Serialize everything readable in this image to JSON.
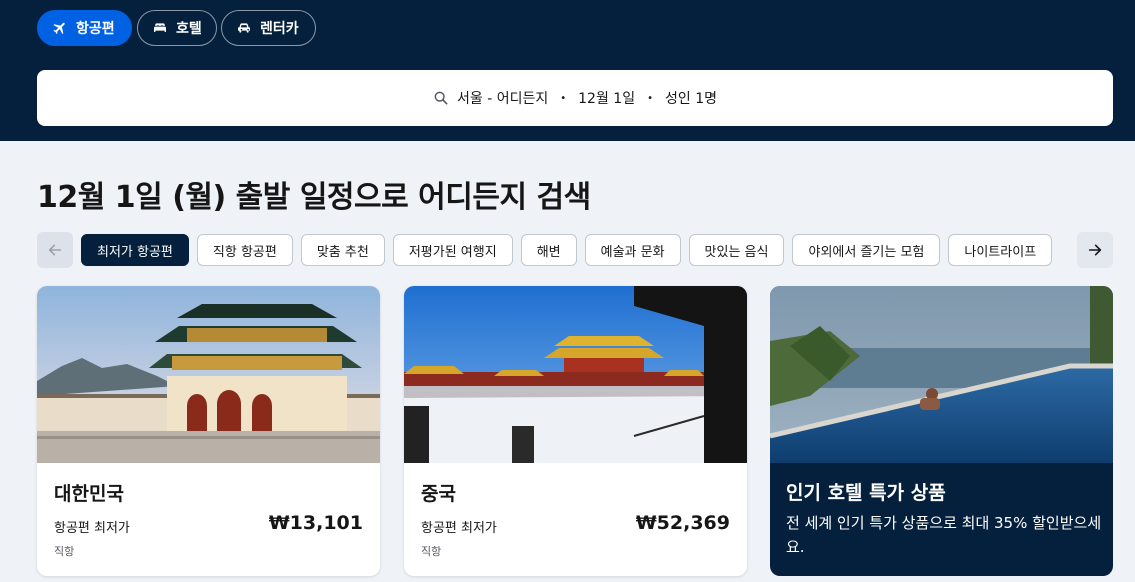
{
  "nav": {
    "tabs": [
      {
        "label": "항공편",
        "icon": "plane-icon",
        "active": true
      },
      {
        "label": "호텔",
        "icon": "bed-icon",
        "active": false
      },
      {
        "label": "렌터카",
        "icon": "car-icon",
        "active": false
      }
    ]
  },
  "search": {
    "route": "서울 - 어디든지",
    "date": "12월 1일",
    "travelers": "성인 1명",
    "separator": "•"
  },
  "page": {
    "heading": "12월 1일 (월) 출발 일정으로 어디든지 검색"
  },
  "filters": {
    "chips": [
      "최저가 항공편",
      "직항 항공편",
      "맞춤 추천",
      "저평가된 여행지",
      "해변",
      "예술과 문화",
      "맛있는 음식",
      "야외에서 즐기는 모험",
      "나이트라이프"
    ],
    "active_index": 0
  },
  "results": [
    {
      "title": "대한민국",
      "subtitle": "항공편 최저가",
      "price": "₩13,101",
      "meta": "직항"
    },
    {
      "title": "중국",
      "subtitle": "항공편 최저가",
      "price": "₩52,369",
      "meta": "직항"
    }
  ],
  "promo": {
    "title": "인기 호텔 특가 상품",
    "description": "전 세계 인기 특가 상품으로 최대 35% 할인받으세요."
  },
  "colors": {
    "header_bg": "#05203c",
    "accent": "#0062e3",
    "page_bg": "#eff3f8"
  }
}
